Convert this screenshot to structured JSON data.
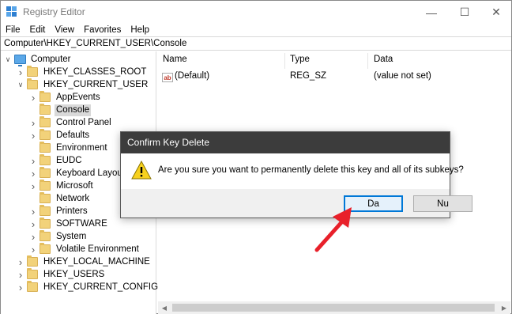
{
  "window": {
    "title": "Registry Editor",
    "minimize_glyph": "—",
    "maximize_glyph": "☐",
    "close_glyph": "✕"
  },
  "menu": [
    "File",
    "Edit",
    "View",
    "Favorites",
    "Help"
  ],
  "address": "Computer\\HKEY_CURRENT_USER\\Console",
  "tree": [
    {
      "label": "Computer",
      "level": 0,
      "toggle": "expanded",
      "icon": "computer-icon"
    },
    {
      "label": "HKEY_CLASSES_ROOT",
      "level": 1,
      "toggle": "collapsed",
      "icon": "folder-icon"
    },
    {
      "label": "HKEY_CURRENT_USER",
      "level": 1,
      "toggle": "expanded",
      "icon": "folder-icon"
    },
    {
      "label": "AppEvents",
      "level": 2,
      "toggle": "collapsed",
      "icon": "folder-icon"
    },
    {
      "label": "Console",
      "level": 2,
      "toggle": "none",
      "icon": "folder-icon",
      "selected": true
    },
    {
      "label": "Control Panel",
      "level": 2,
      "toggle": "collapsed",
      "icon": "folder-icon"
    },
    {
      "label": "Defaults",
      "level": 2,
      "toggle": "collapsed",
      "icon": "folder-icon"
    },
    {
      "label": "Environment",
      "level": 2,
      "toggle": "none",
      "icon": "folder-icon"
    },
    {
      "label": "EUDC",
      "level": 2,
      "toggle": "collapsed",
      "icon": "folder-icon"
    },
    {
      "label": "Keyboard Layout",
      "level": 2,
      "toggle": "collapsed",
      "icon": "folder-icon"
    },
    {
      "label": "Microsoft",
      "level": 2,
      "toggle": "collapsed",
      "icon": "folder-icon"
    },
    {
      "label": "Network",
      "level": 2,
      "toggle": "none",
      "icon": "folder-icon"
    },
    {
      "label": "Printers",
      "level": 2,
      "toggle": "collapsed",
      "icon": "folder-icon"
    },
    {
      "label": "SOFTWARE",
      "level": 2,
      "toggle": "collapsed",
      "icon": "folder-icon"
    },
    {
      "label": "System",
      "level": 2,
      "toggle": "collapsed",
      "icon": "folder-icon"
    },
    {
      "label": "Volatile Environment",
      "level": 2,
      "toggle": "collapsed",
      "icon": "folder-icon"
    },
    {
      "label": "HKEY_LOCAL_MACHINE",
      "level": 1,
      "toggle": "collapsed",
      "icon": "folder-icon"
    },
    {
      "label": "HKEY_USERS",
      "level": 1,
      "toggle": "collapsed",
      "icon": "folder-icon"
    },
    {
      "label": "HKEY_CURRENT_CONFIG",
      "level": 1,
      "toggle": "collapsed",
      "icon": "folder-icon"
    }
  ],
  "list": {
    "columns": [
      "Name",
      "Type",
      "Data"
    ],
    "rows": [
      {
        "name": "(Default)",
        "type": "REG_SZ",
        "data": "(value not set)",
        "icon": "ab"
      }
    ]
  },
  "dialog": {
    "title": "Confirm Key Delete",
    "message": "Are you sure you want to permanently delete this key and all of its subkeys?",
    "yes_label": "Da",
    "no_label": "Nu",
    "icon": "warning-icon"
  },
  "colors": {
    "dialog_titlebar": "#3c3c3c",
    "default_button_border": "#0078d7",
    "arrow": "#e8202a",
    "selected_row": "#d9d9d9"
  }
}
